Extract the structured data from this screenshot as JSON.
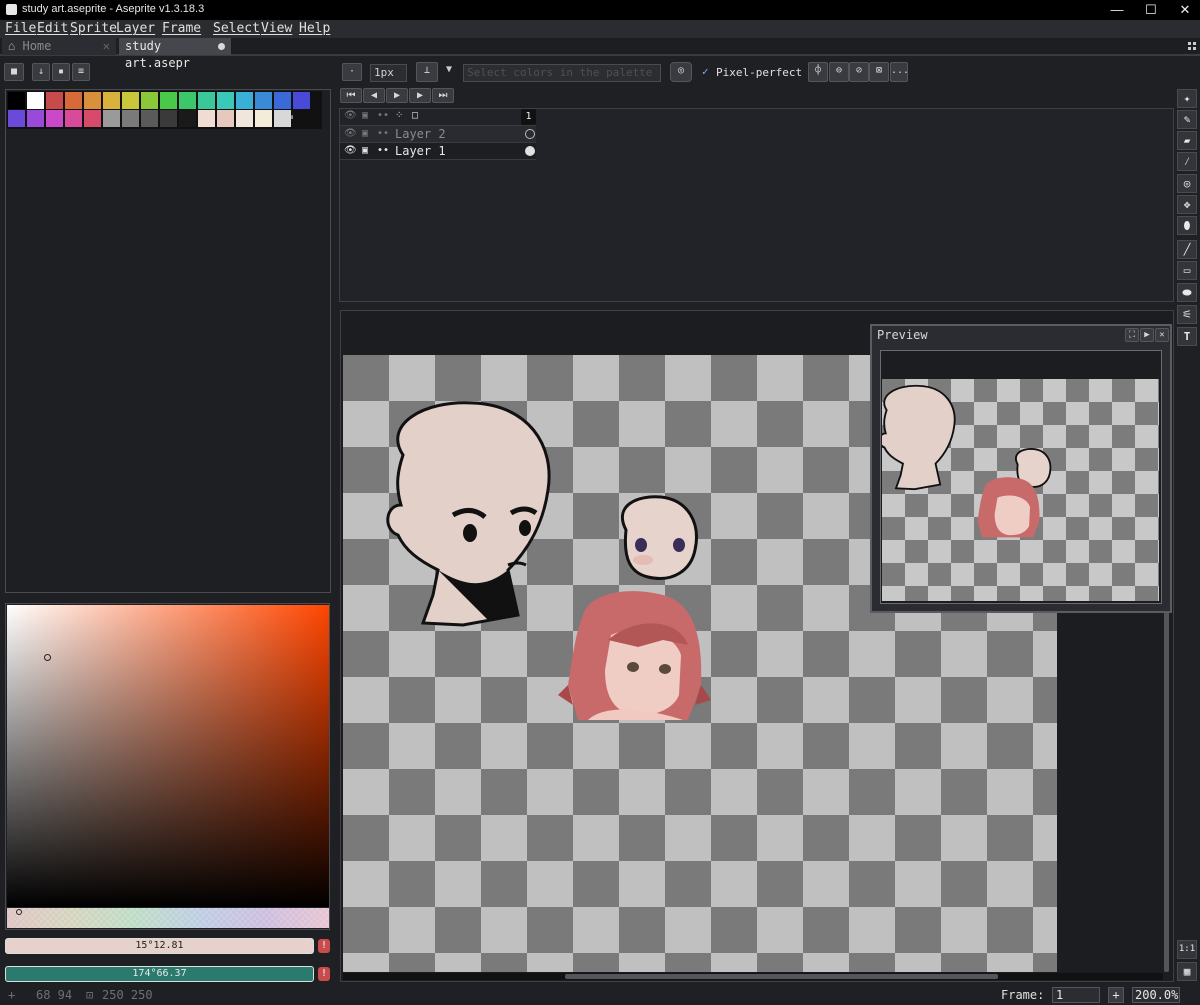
{
  "window": {
    "title": "study art.aseprite - Aseprite v1.3.18.3",
    "min": "—",
    "max": "☐",
    "close": "✕"
  },
  "menus": [
    "File",
    "Edit",
    "Sprite",
    "Layer",
    "Frame",
    "Select",
    "View",
    "Help"
  ],
  "tabs": {
    "home": "Home",
    "document": "study art.asepr"
  },
  "toolbar": {
    "brush_size": "1px",
    "color_placeholder": "Select colors in the palette",
    "pixel_perfect_label": "Pixel-perfect",
    "pixel_perfect_checked": true,
    "more_label": "..."
  },
  "palette": {
    "row1": [
      "#000000",
      "#ffffff",
      "#c84a4a",
      "#d86a3a",
      "#d8903a",
      "#d8b23a",
      "#c8c83a",
      "#8ac83a",
      "#4ac84a",
      "#3ac86a",
      "#3ac89a",
      "#3ac8b8",
      "#3ab0d8",
      "#3a8ad8",
      "#3a6ad8",
      "#4a4ad8"
    ],
    "row2": [
      "#6a4ad8",
      "#9a4ad8",
      "#c84ac8",
      "#d84a9a",
      "#d84a6a",
      "#9a9a9a",
      "#7a7a7a",
      "#5a5a5a",
      "#3a3a3a",
      "#1a1a1a",
      "#f0dcd2",
      "#e8c8be",
      "#f0e6dc",
      "#f2ecd8",
      "#d8d8d8"
    ]
  },
  "colors": {
    "foreground_value": "15°12.81",
    "foreground_color": "#e6d2cb",
    "background_value": "174°66.37",
    "background_color": "#2a7a6e",
    "accent": "#ff4500"
  },
  "timeline": {
    "frame_number": "1",
    "layers": [
      {
        "name": "Layer 2",
        "visible": true,
        "active": false
      },
      {
        "name": "Layer 1",
        "visible": true,
        "active": true
      }
    ]
  },
  "preview": {
    "title": "Preview"
  },
  "tools": [
    "selection-icon",
    "pencil-icon",
    "eraser-icon",
    "eyedropper-icon",
    "zoom-icon",
    "move-icon",
    "fill-icon",
    "line-icon",
    "rectangle-icon",
    "blur-icon",
    "spray-icon",
    "text-icon"
  ],
  "status": {
    "cursor_position": "68 94",
    "sprite_size": "250 250",
    "frame_label": "Frame:",
    "frame_value": "1",
    "zoom": "200.0%",
    "zoom_in": "+"
  }
}
